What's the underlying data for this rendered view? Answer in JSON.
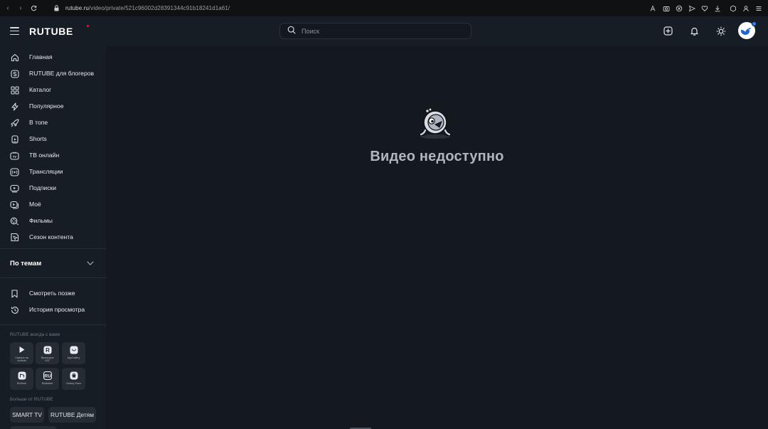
{
  "browser": {
    "url_domain": "rutube.ru",
    "url_path": "/video/private/521c96002d28391344c91b18241d1a61/"
  },
  "header": {
    "logo": "RUTUBE",
    "search_placeholder": "Поиск"
  },
  "sidebar": {
    "items": [
      {
        "label": "Главная",
        "icon": "home-icon"
      },
      {
        "label": "RUTUBE для блогеров",
        "icon": "bloggers-icon"
      },
      {
        "label": "Каталог",
        "icon": "catalog-icon"
      },
      {
        "label": "Популярное",
        "icon": "lightning-icon"
      },
      {
        "label": "В топе",
        "icon": "rocket-icon"
      },
      {
        "label": "Shorts",
        "icon": "shorts-icon"
      },
      {
        "label": "ТВ онлайн",
        "icon": "tv-icon"
      },
      {
        "label": "Трансляции",
        "icon": "broadcast-icon"
      },
      {
        "label": "Подписки",
        "icon": "subscriptions-icon"
      },
      {
        "label": "Моё",
        "icon": "my-icon"
      },
      {
        "label": "Фильмы",
        "icon": "films-icon"
      },
      {
        "label": "Сезон контента",
        "icon": "season-icon"
      }
    ],
    "topics_label": "По темам",
    "personal": [
      {
        "label": "Смотреть позже",
        "icon": "bookmark-icon"
      },
      {
        "label": "История просмотра",
        "icon": "history-icon"
      }
    ],
    "apps_caption": "RUTUBE всегда с вами",
    "apps": [
      {
        "label": "Скачать на Android",
        "icon": "google-play-icon"
      },
      {
        "label": "Ярлык для iOS",
        "icon": "ios-shortcut-icon"
      },
      {
        "label": "AppGallery",
        "icon": "appgallery-icon"
      },
      {
        "label": "RuStore",
        "icon": "rustore-icon"
      },
      {
        "label": "RuMarket",
        "icon": "rumarket-icon"
      },
      {
        "label": "Galaxy Store",
        "icon": "galaxy-store-icon"
      }
    ],
    "more_caption": "Больше от RUTUBE",
    "more": [
      {
        "label": "SMART TV"
      },
      {
        "label": "RUTUBE Детям"
      }
    ]
  },
  "main": {
    "message": "Видео недоступно"
  }
}
